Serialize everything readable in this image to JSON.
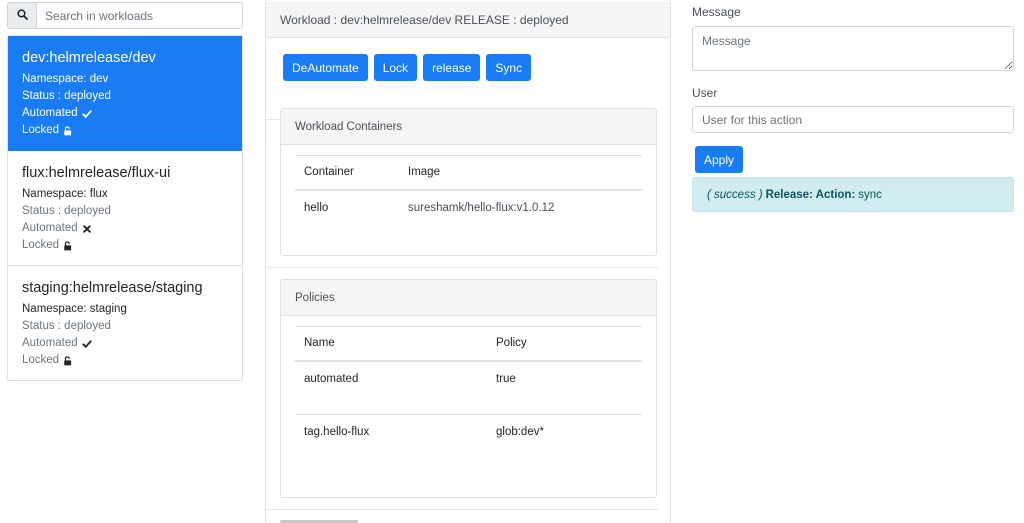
{
  "search": {
    "placeholder": "Search in workloads",
    "icon": "search-icon"
  },
  "workloads": [
    {
      "title": "dev:helmrelease/dev",
      "namespace": "Namespace: dev",
      "status": "Status : deployed",
      "automated_label": "Automated",
      "automated": true,
      "locked_label": "Locked",
      "active": true
    },
    {
      "title": "flux:helmrelease/flux-ui",
      "namespace": "Namespace: flux",
      "status": "Status : deployed",
      "automated_label": "Automated",
      "automated": false,
      "locked_label": "Locked",
      "active": false
    },
    {
      "title": "staging:helmrelease/staging",
      "namespace": "Namespace: staging",
      "status": "Status : deployed",
      "automated_label": "Automated",
      "automated": true,
      "locked_label": "Locked",
      "active": false
    }
  ],
  "main": {
    "header": "Workload : dev:helmrelease/dev RELEASE : deployed",
    "buttons": {
      "deautomate": "DeAutomate",
      "lock": "Lock",
      "release": "release",
      "sync": "Sync"
    },
    "containers": {
      "title": "Workload Containers",
      "columns": [
        "Container",
        "Image"
      ],
      "rows": [
        {
          "container": "hello",
          "image": "sureshamk/hello-flux:v1.0.12"
        }
      ]
    },
    "policies": {
      "title": "Policies",
      "columns": [
        "Name",
        "Policy"
      ],
      "rows": [
        {
          "name": "automated",
          "policy": "true"
        },
        {
          "name": "tag.hello-flux",
          "policy": "glob:dev*"
        }
      ]
    }
  },
  "action": {
    "message_label": "Message",
    "message_placeholder": "Message",
    "user_label": "User",
    "user_placeholder": "User for this action",
    "apply_label": "Apply",
    "alert": {
      "status": "( success )",
      "label": "Release: Action:",
      "value": "sync"
    }
  },
  "colors": {
    "primary": "#1a7cf5",
    "alert_bg": "#d1ecf1",
    "alert_text": "#0c5460"
  }
}
